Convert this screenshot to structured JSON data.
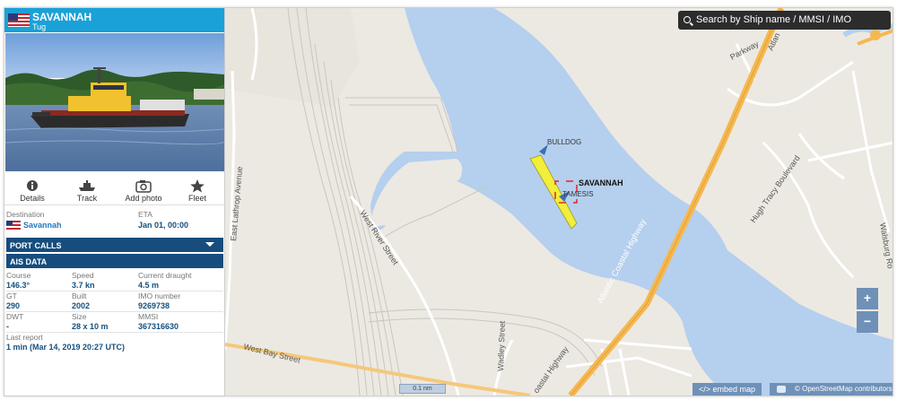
{
  "vessel": {
    "name": "SAVANNAH",
    "type": "Tug",
    "flag_colors": {
      "stripe": "#c0282d",
      "canton": "#2b3a75"
    }
  },
  "actions": [
    {
      "label": "Details",
      "icon": "info-icon"
    },
    {
      "label": "Track",
      "icon": "ship-track-icon"
    },
    {
      "label": "Add photo",
      "icon": "camera-icon"
    },
    {
      "label": "Fleet",
      "icon": "star-icon"
    }
  ],
  "voyage": {
    "destination_label": "Destination",
    "destination": "Savannah",
    "eta_label": "ETA",
    "eta": "Jan 01, 00:00"
  },
  "sections": {
    "port_calls": "PORT CALLS",
    "ais_data": "AIS DATA"
  },
  "ais": {
    "course_label": "Course",
    "course": "146.3°",
    "speed_label": "Speed",
    "speed": "3.7 kn",
    "draught_label": "Current draught",
    "draught": "4.5 m",
    "gt_label": "GT",
    "gt": "290",
    "built_label": "Built",
    "built": "2002",
    "imo_label": "IMO number",
    "imo": "9269738",
    "dwt_label": "DWT",
    "dwt": "-",
    "size_label": "Size",
    "size": "28 x 10 m",
    "mmsi_label": "MMSI",
    "mmsi": "367316630",
    "last_report_label": "Last report",
    "last_report": "1 min (Mar 14, 2019 20:27 UTC)"
  },
  "map": {
    "search_placeholder": "Search by Ship name / MMSI / IMO",
    "zoom_in": "+",
    "zoom_out": "−",
    "scale": "0.1 nm",
    "embed": "</> embed map",
    "attribution": "© OpenStreetMap contributors",
    "ship_labels": {
      "selected": "SAVANNAH",
      "other1": "BULLDOG",
      "other2": "TAMESIS"
    },
    "street_labels": {
      "parkway": "Parkway",
      "atlantic_top": "Atlan",
      "east_lathrop": "East Lathrop Avenue",
      "west_river": "West River Street",
      "atlantic_highway": "Atlantic Coastal Highway",
      "hugh_tracy": "Hugh Tracy Boulevard",
      "waldburg": "Walsburg Ro",
      "wadley": "Wadley Street",
      "west_bay": "West Bay Street",
      "coastal_highway_bottom": "oastal Highway"
    },
    "colors": {
      "water": "#b5cfee",
      "land": "#ece9e2",
      "highway": "#f5b851",
      "selected_ship": "#f2ee3a",
      "other_ship": "#3d6fb5",
      "selection_box": "#e2252b"
    }
  }
}
